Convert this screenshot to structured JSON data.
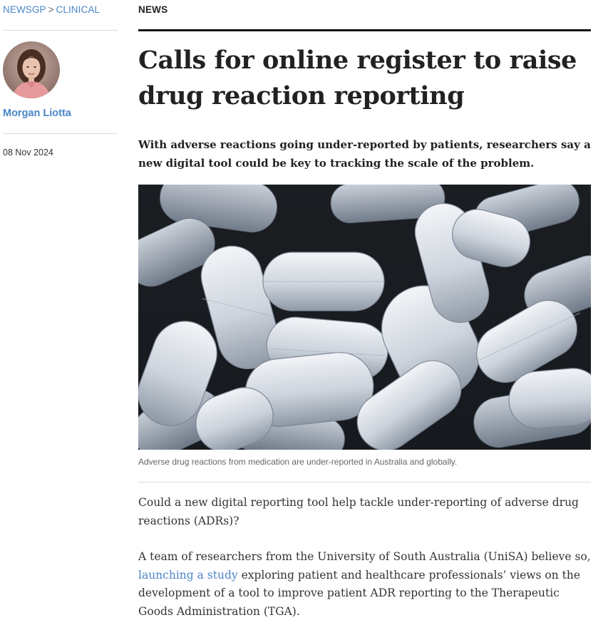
{
  "breadcrumb": {
    "home": "NEWSGP",
    "separator": ">",
    "section": "CLINICAL"
  },
  "author": {
    "name": "Morgan Liotta"
  },
  "date": "08 Nov 2024",
  "category": "NEWS",
  "article": {
    "title": "Calls for online register to raise drug reaction reporting",
    "standfirst": "With adverse reactions going under-reported by patients, researchers say a new digital tool could be key to tracking the scale of the problem.",
    "image_caption": "Adverse drug reactions from medication are under-reported in Australia and globally.",
    "paragraph1": "Could a new digital reporting tool help tackle under-reporting of adverse drug reactions (ADRs)?",
    "paragraph2_before": "A team of researchers from the University of South Australia (UniSA) believe so, ",
    "paragraph2_link": "launching a study",
    "paragraph2_after": " exploring patient and healthcare professionals’ views on the development of a tool to improve patient ADR reporting to the Therapeutic Goods Administration (TGA)."
  },
  "colors": {
    "link": "#4a86c8",
    "text": "#222222",
    "rule": "#111111"
  }
}
